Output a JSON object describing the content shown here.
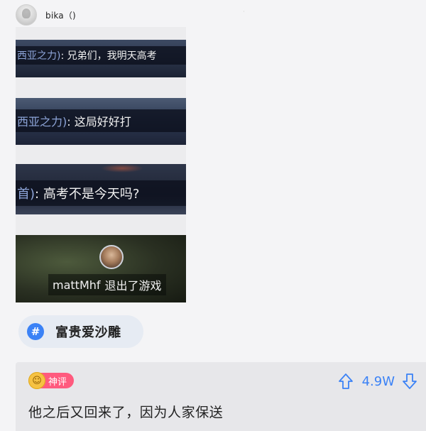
{
  "post": {
    "username": "bika（)",
    "frames": [
      {
        "speaker": "西亚之力)",
        "text": ": 兄弟们，我明天高考"
      },
      {
        "speaker": "西亚之力)",
        "text": ": 这局好好打"
      },
      {
        "speaker": "首)",
        "text": ": 高考不是今天吗?"
      },
      {
        "player": "mattMhf",
        "text": "退出了游戏"
      }
    ]
  },
  "topic": {
    "icon": "#",
    "label": "富贵爱沙雕"
  },
  "comment": {
    "badge": "神评",
    "badge_icon": "smile-icon",
    "vote_count": "4.9W",
    "text": "他之后又回来了，因为人家保送",
    "accent_color": "#3b82f6",
    "badge_color": "#ff5a7e"
  }
}
